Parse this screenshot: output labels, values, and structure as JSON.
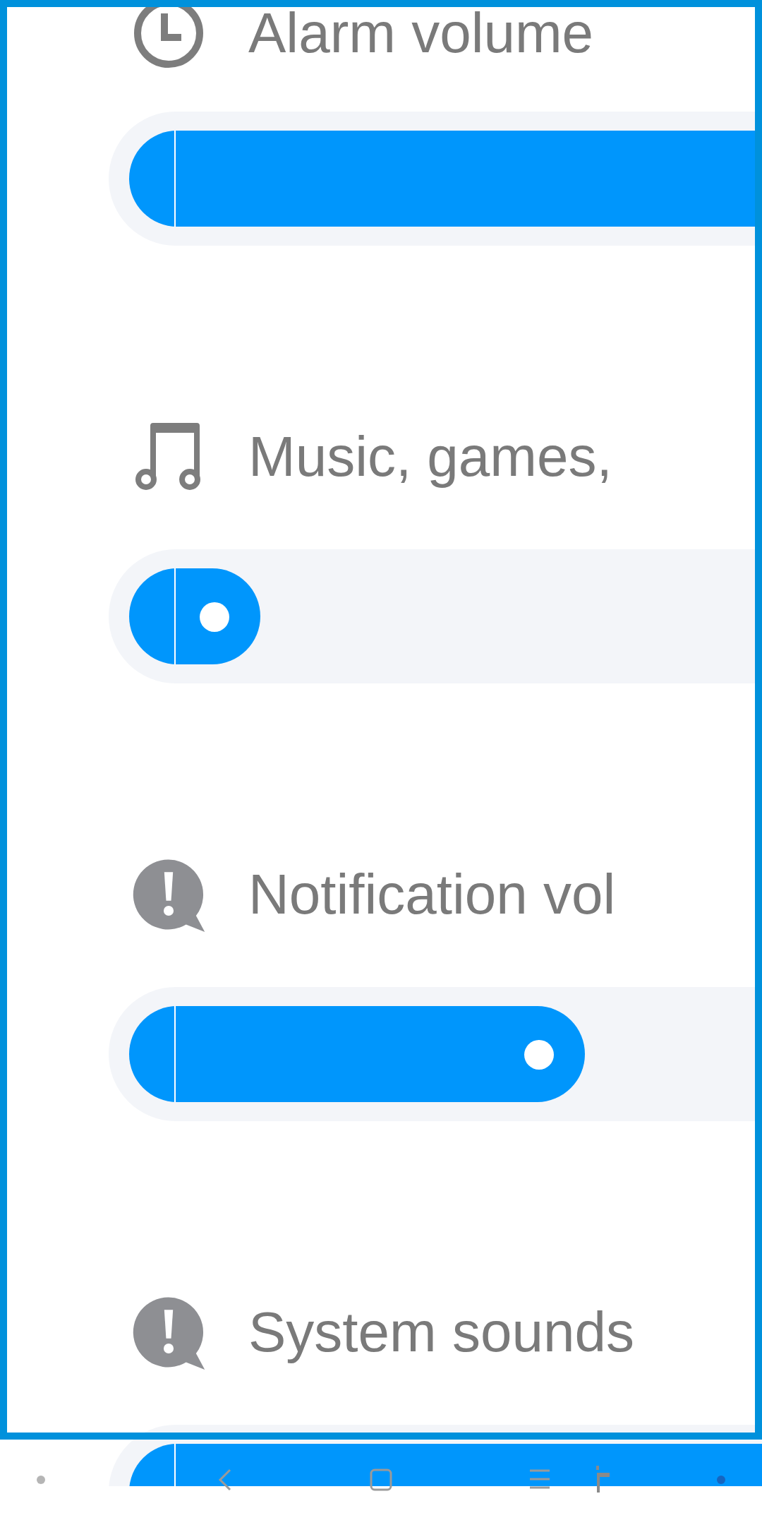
{
  "sliders": [
    {
      "label": "Alarm volume",
      "kind": "clock"
    },
    {
      "label": "Music, games,",
      "kind": "music"
    },
    {
      "label": "Notification vol",
      "kind": "alert"
    },
    {
      "label": "System sounds",
      "kind": "alert"
    }
  ]
}
